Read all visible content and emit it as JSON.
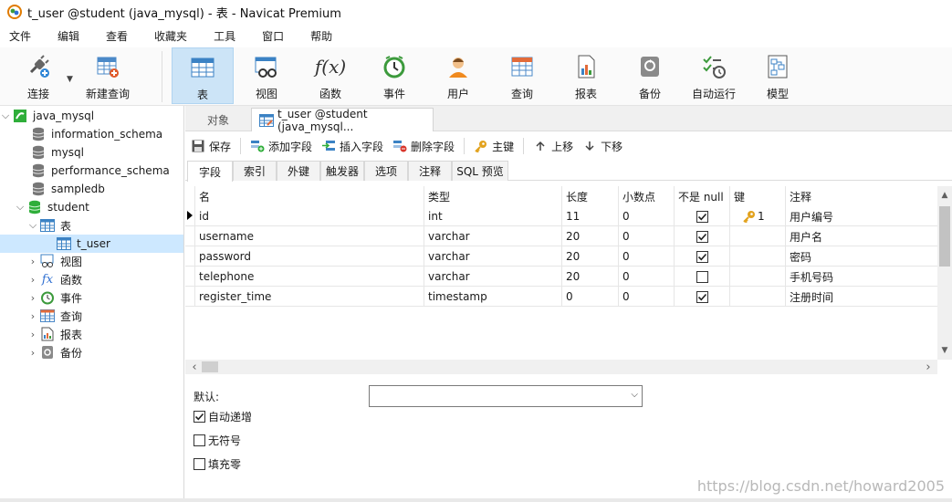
{
  "window": {
    "title": "t_user @student (java_mysql) - 表 - Navicat Premium"
  },
  "menu": [
    "文件",
    "编辑",
    "查看",
    "收藏夹",
    "工具",
    "窗口",
    "帮助"
  ],
  "toolbar": {
    "connect": "连接",
    "new_query": "新建查询",
    "table": "表",
    "view": "视图",
    "function": "函数",
    "event": "事件",
    "user": "用户",
    "query": "查询",
    "report": "报表",
    "backup": "备份",
    "autorun": "自动运行",
    "model": "模型"
  },
  "tree": {
    "connection": "java_mysql",
    "databases": [
      "information_schema",
      "mysql",
      "performance_schema",
      "sampledb",
      "student"
    ],
    "tables_group": "表",
    "selected_table": "t_user",
    "groups": [
      "视图",
      "函数",
      "事件",
      "查询",
      "报表",
      "备份"
    ]
  },
  "tabs": {
    "objects": "对象",
    "current": "t_user @student (java_mysql..."
  },
  "actions": {
    "save": "保存",
    "add_field": "添加字段",
    "insert_field": "插入字段",
    "delete_field": "删除字段",
    "primary_key": "主键",
    "move_up": "上移",
    "move_down": "下移"
  },
  "subtabs": [
    "字段",
    "索引",
    "外键",
    "触发器",
    "选项",
    "注释",
    "SQL 预览"
  ],
  "grid": {
    "columns": [
      "名",
      "类型",
      "长度",
      "小数点",
      "不是 null",
      "键",
      "注释"
    ],
    "rows": [
      {
        "name": "id",
        "type": "int",
        "length": "11",
        "decimals": "0",
        "not_null": true,
        "key": "1",
        "comment": "用户编号"
      },
      {
        "name": "username",
        "type": "varchar",
        "length": "20",
        "decimals": "0",
        "not_null": true,
        "key": "",
        "comment": "用户名"
      },
      {
        "name": "password",
        "type": "varchar",
        "length": "20",
        "decimals": "0",
        "not_null": true,
        "key": "",
        "comment": "密码"
      },
      {
        "name": "telephone",
        "type": "varchar",
        "length": "20",
        "decimals": "0",
        "not_null": false,
        "key": "",
        "comment": "手机号码"
      },
      {
        "name": "register_time",
        "type": "timestamp",
        "length": "0",
        "decimals": "0",
        "not_null": true,
        "key": "",
        "comment": "注册时间"
      }
    ]
  },
  "props": {
    "default_label": "默认:",
    "default_value": "",
    "auto_increment": {
      "label": "自动递增",
      "checked": true
    },
    "unsigned": {
      "label": "无符号",
      "checked": false
    },
    "zerofill": {
      "label": "填充零",
      "checked": false
    }
  },
  "watermark": "https://blog.csdn.net/howard2005"
}
